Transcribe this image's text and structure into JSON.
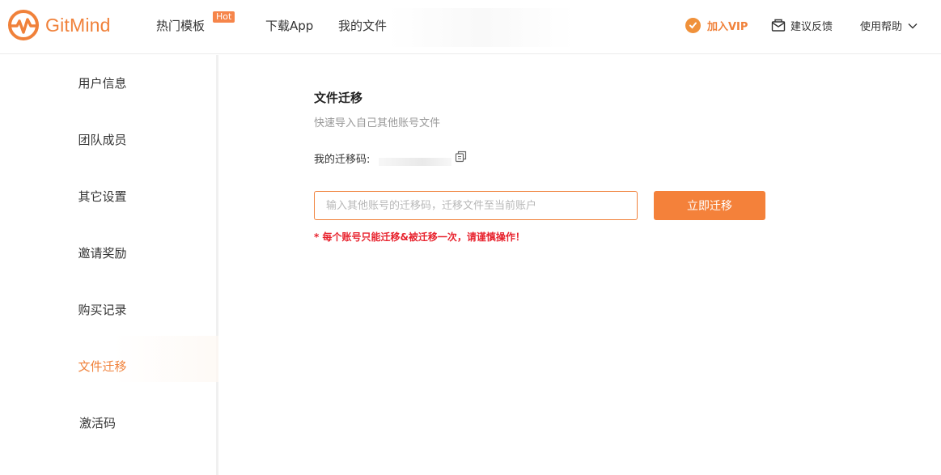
{
  "header": {
    "logo_text": "GitMind",
    "nav": [
      {
        "label": "热门模板",
        "badge": "Hot"
      },
      {
        "label": "下载App"
      },
      {
        "label": "我的文件"
      }
    ],
    "vip_label": "加入VIP",
    "feedback_label": "建议反馈",
    "help_label": "使用帮助"
  },
  "sidebar": {
    "items": [
      {
        "label": "用户信息"
      },
      {
        "label": "团队成员"
      },
      {
        "label": "其它设置"
      },
      {
        "label": "邀请奖励"
      },
      {
        "label": "购买记录"
      },
      {
        "label": "文件迁移",
        "active": true
      },
      {
        "label": "激活码"
      }
    ]
  },
  "main": {
    "title": "文件迁移",
    "subtitle": "快速导入自己其他账号文件",
    "code_label": "我的迁移码:",
    "input_placeholder": "输入其他账号的迁移码，迁移文件至当前账户",
    "button_label": "立即迁移",
    "warning": "* 每个账号只能迁移&被迁移一次，请谨慎操作！"
  },
  "colors": {
    "accent": "#f0813a",
    "warning": "#e8242f"
  }
}
